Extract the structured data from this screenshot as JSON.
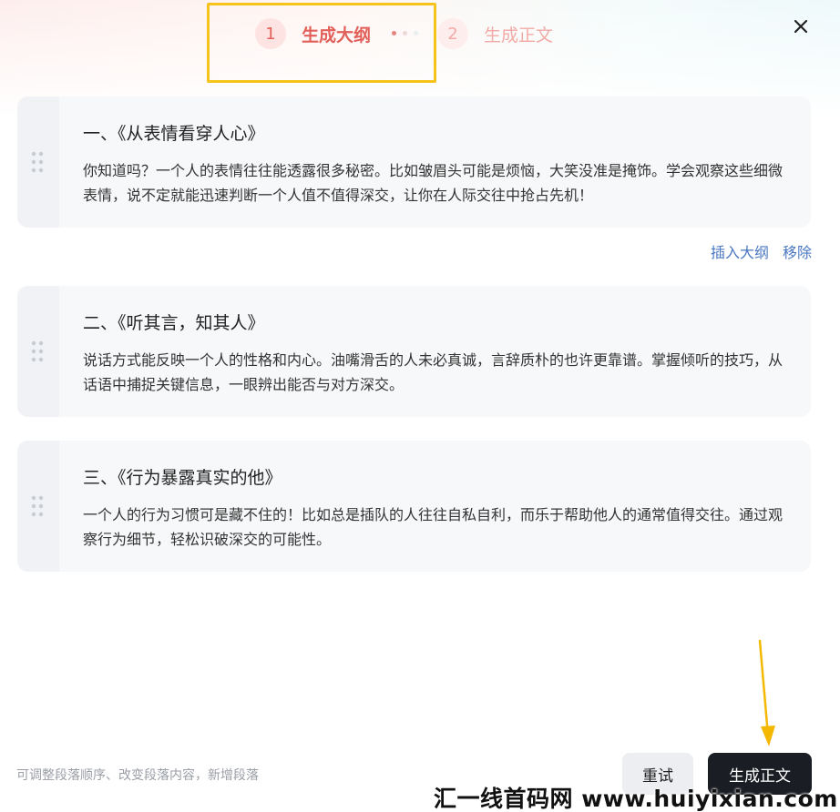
{
  "steps": [
    {
      "number": "1",
      "label": "生成大纲"
    },
    {
      "number": "2",
      "label": "生成正文"
    }
  ],
  "outline": [
    {
      "title": "一、《从表情看穿人心》",
      "body": "你知道吗？一个人的表情往往能透露很多秘密。比如皱眉头可能是烦恼，大笑没准是掩饰。学会观察这些细微表情，说不定就能迅速判断一个人值不值得深交，让你在人际交往中抢占先机！"
    },
    {
      "title": "二、《听其言，知其人》",
      "body": "说话方式能反映一个人的性格和内心。油嘴滑舌的人未必真诚，言辞质朴的也许更靠谱。掌握倾听的技巧，从话语中捕捉关键信息，一眼辨出能否与对方深交。"
    },
    {
      "title": "三、《行为暴露真实的他》",
      "body": "一个人的行为习惯可是藏不住的！比如总是插队的人往往自私自利，而乐于帮助他人的通常值得交往。通过观察行为细节，轻松识破深交的可能性。"
    }
  ],
  "card_actions": {
    "insert": "插入大纲",
    "remove": "移除"
  },
  "footer": {
    "hint": "可调整段落顺序、改变段落内容，新增段落",
    "retry_label": "重试",
    "generate_label": "生成正文"
  },
  "watermark": "汇一线首码网 www.huiyixian.com",
  "colors": {
    "accent": "#e2605a",
    "primary_button": "#1a1d24",
    "link": "#4a78c2",
    "highlight_box": "#f5c31a",
    "arrow": "#f5b800"
  }
}
